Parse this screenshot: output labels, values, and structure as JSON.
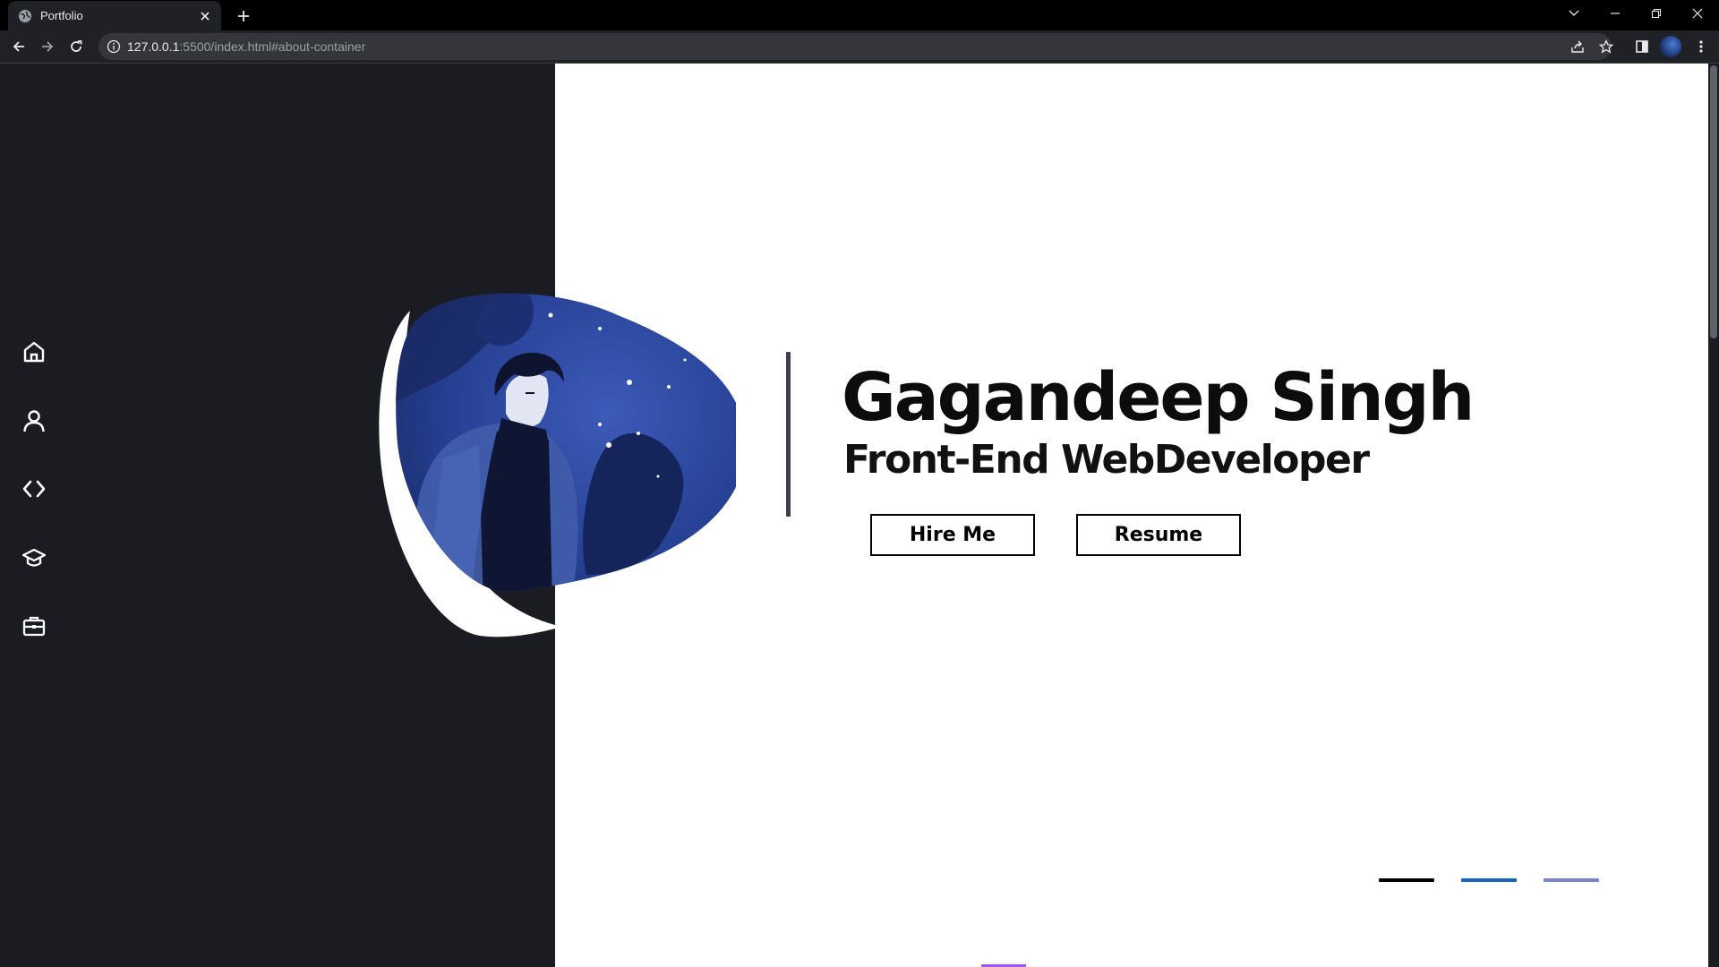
{
  "browser": {
    "tab_title": "Portfolio",
    "url_host": "127.0.0.1",
    "url_rest": ":5500/index.html#about-container"
  },
  "sidebar": {
    "items": [
      {
        "icon": "home-icon"
      },
      {
        "icon": "user-icon"
      },
      {
        "icon": "code-icon"
      },
      {
        "icon": "graduation-cap-icon"
      },
      {
        "icon": "briefcase-icon"
      }
    ]
  },
  "hero": {
    "name": "Gagandeep Singh",
    "role": "Front-End WebDeveloper",
    "hire_label": "Hire Me",
    "resume_label": "Resume"
  },
  "pager": {
    "colors": [
      "#000000",
      "#1565c0",
      "#7986cb"
    ]
  },
  "colors": {
    "sidebar_bg": "#1b1c21",
    "accent": "#a152ff"
  }
}
